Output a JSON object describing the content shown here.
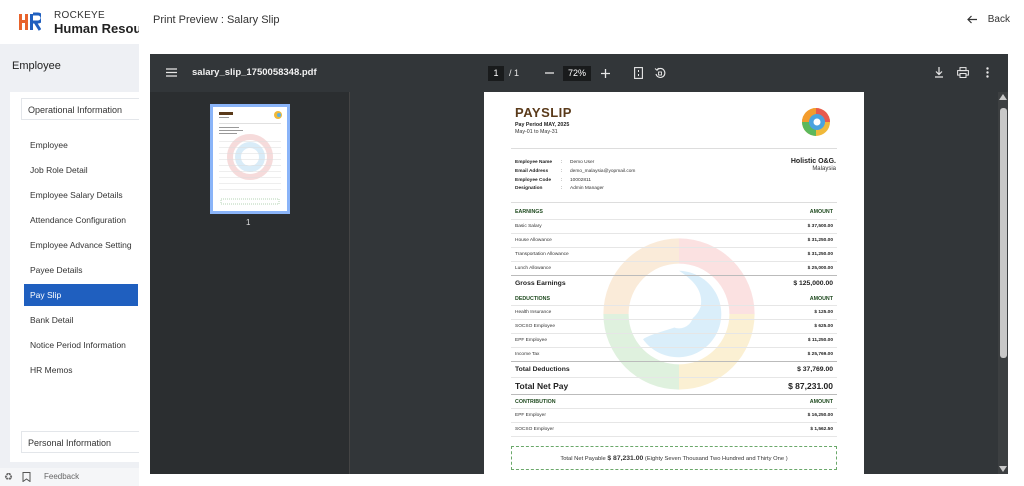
{
  "brand": {
    "line1": "ROCKEYE",
    "line2": "Human Resou"
  },
  "sidebar": {
    "section_title": "Employee",
    "group_top": "Operational Information",
    "group_bottom": "Personal Information",
    "items": [
      {
        "label": "Employee"
      },
      {
        "label": "Job Role Detail"
      },
      {
        "label": "Employee Salary Details"
      },
      {
        "label": "Attendance Configuration"
      },
      {
        "label": "Employee Advance Setting"
      },
      {
        "label": "Payee Details"
      },
      {
        "label": "Pay Slip",
        "active": true
      },
      {
        "label": "Bank Detail"
      },
      {
        "label": "Notice Period Information"
      },
      {
        "label": "HR Memos"
      }
    ],
    "feedback": "Feedback"
  },
  "header": {
    "title": "Print Preview : Salary Slip",
    "back": "Back"
  },
  "viewer": {
    "file_name": "salary_slip_1750058348.pdf",
    "page_current": "1",
    "page_total": "/ 1",
    "zoom": "72%",
    "thumb_number": "1"
  },
  "payslip": {
    "title": "PAYSLIP",
    "pay_period": "Pay Period MAY, 2025",
    "range": "May-01 to May-31",
    "company": "Holistic O&G.",
    "country": "Malaysia",
    "employee": [
      {
        "label": "Employee Name",
        "value": "Demo User"
      },
      {
        "label": "Email Address",
        "value": "demo_malaysia@yopmail.com"
      },
      {
        "label": "Employee Code",
        "value": "10002811"
      },
      {
        "label": "Designation",
        "value": "Admin Manager"
      }
    ],
    "earnings_head": "EARNINGS",
    "amount_head": "AMOUNT",
    "earnings": [
      {
        "label": "Basic Salary",
        "value": "$ 37,500.00"
      },
      {
        "label": "House Allowance",
        "value": "$ 31,250.00"
      },
      {
        "label": "Transportation Allowance",
        "value": "$ 31,250.00"
      },
      {
        "label": "Lunch Allowance",
        "value": "$ 25,000.00"
      }
    ],
    "gross_label": "Gross Earnings",
    "gross_value": "$ 125,000.00",
    "deductions_head": "DEDUCTIONS",
    "deductions": [
      {
        "label": "Health Insurance",
        "value": "$ 125.00"
      },
      {
        "label": "SOCSO Employee",
        "value": "$ 625.00"
      },
      {
        "label": "EPF Employee",
        "value": "$ 11,250.00"
      },
      {
        "label": "Income Tax",
        "value": "$ 25,769.00"
      }
    ],
    "total_deductions_label": "Total Deductions",
    "total_deductions_value": "$ 37,769.00",
    "net_pay_label": "Total Net Pay",
    "net_pay_value": "$ 87,231.00",
    "contribution_head": "CONTRIBUTION",
    "contributions": [
      {
        "label": "EPF Employer",
        "value": "$ 16,250.00"
      },
      {
        "label": "SOCSO Employer",
        "value": "$ 1,562.50"
      }
    ],
    "net_box_prefix": "Total Net Payable",
    "net_box_amount": "$ 87,231.00",
    "net_box_words": "(Eighty Seven Thousand Two Hundred and Thirty One )"
  },
  "icons": [
    "menu-icon",
    "minus-icon",
    "plus-icon",
    "fit-page-icon",
    "rotate-icon",
    "download-icon",
    "print-icon",
    "more-icon",
    "back-arrow-icon",
    "bookmark-icon",
    "recycle-icon"
  ],
  "colors": {
    "active_blue": "#1f5fbf",
    "viewer_dark": "#323639",
    "payslip_brown": "#5a3a1a",
    "section_green": "#1f4a1f"
  }
}
